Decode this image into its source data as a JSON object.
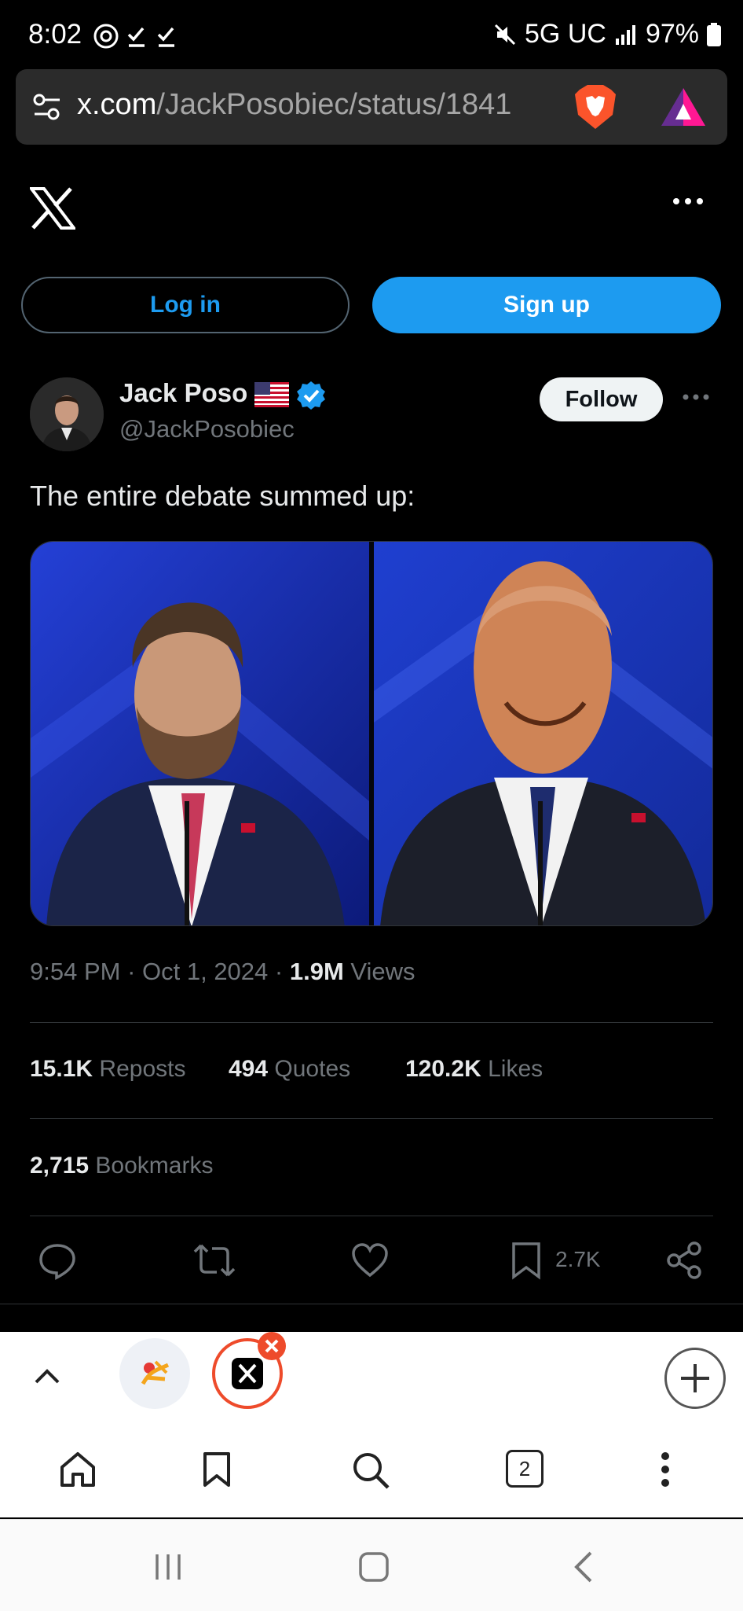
{
  "status_bar": {
    "time": "8:02",
    "network": "5G UC",
    "battery": "97%"
  },
  "browser": {
    "url_host": "x.com",
    "url_path": "/JackPosobiec/status/1841",
    "tab_count": "2"
  },
  "x_header": {
    "login_label": "Log in",
    "signup_label": "Sign up"
  },
  "tweet": {
    "author_name": "Jack Poso",
    "author_handle": "@JackPosobiec",
    "follow_label": "Follow",
    "text": "The entire debate summed up:",
    "time": "9:54 PM",
    "date": "Oct 1, 2024",
    "views_value": "1.9M",
    "views_label": "Views",
    "stats": {
      "reposts_value": "15.1K",
      "reposts_label": "Reposts",
      "quotes_value": "494",
      "quotes_label": "Quotes",
      "likes_value": "120.2K",
      "likes_label": "Likes",
      "bookmarks_value": "2,715",
      "bookmarks_label": "Bookmarks"
    },
    "bookmark_count": "2.7K"
  },
  "colors": {
    "accent": "#1d9bf0",
    "background": "#000000",
    "muted_text": "#71767b"
  }
}
